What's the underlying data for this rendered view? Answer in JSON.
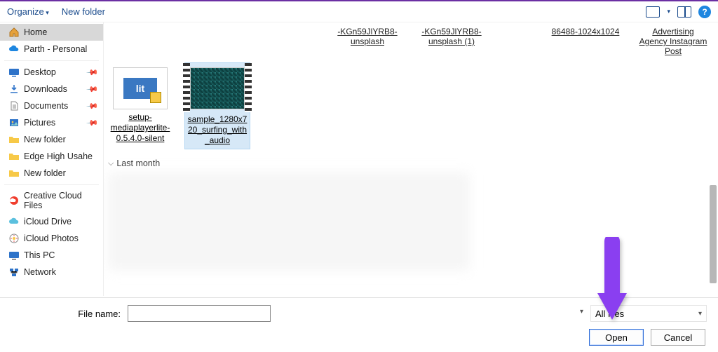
{
  "toolbar": {
    "organize": "Organize",
    "new_folder": "New folder"
  },
  "sidebar": {
    "home": "Home",
    "parth": "Parth - Personal",
    "desktop": "Desktop",
    "downloads": "Downloads",
    "documents": "Documents",
    "pictures": "Pictures",
    "newfolder1": "New folder",
    "edgehigh": "Edge High Usahe",
    "newfolder2": "New folder",
    "ccfiles": "Creative Cloud Files",
    "iclouddrive": "iCloud Drive",
    "icloudphotos": "iCloud Photos",
    "thispc": "This PC",
    "network": "Network"
  },
  "top_items": {
    "a": "-KGn59JlYRB8-unsplash",
    "b": "-KGn59JlYRB8-unsplash (1)",
    "c": "86488-1024x1024",
    "d": "Advertising Agency Instagram Post"
  },
  "files": {
    "setup": "setup-mediaplayerlite-0.5.4.0-silent",
    "sample": "sample_1280x720_surfing_with_audio"
  },
  "group": {
    "lastmonth": "Last month"
  },
  "bottom": {
    "filename_label": "File name:",
    "filename_value": "",
    "filter": "All files",
    "open": "Open",
    "cancel": "Cancel"
  }
}
